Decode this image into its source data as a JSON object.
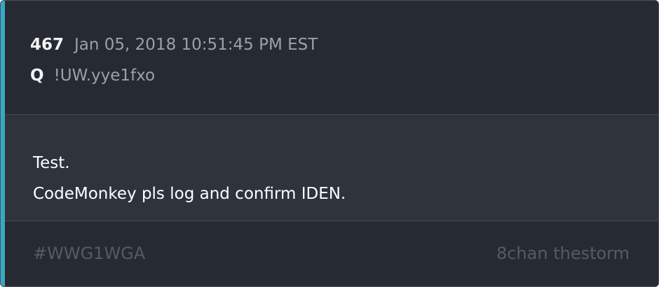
{
  "colors": {
    "card_background": "#262a32",
    "message_background": "#2e333c",
    "accent": "#38a8c4",
    "primary_text": "#f2f3f5",
    "secondary_text": "#9ba1aa",
    "muted_text": "#555b65",
    "divider": "#454b55"
  },
  "post": {
    "number": "467",
    "timestamp": "Jan 05, 2018 10:51:45 PM EST",
    "author": "Q",
    "tripcode": "!UW.yye1fxo",
    "message_lines": [
      "Test.",
      "CodeMonkey pls log and confirm IDEN."
    ]
  },
  "footer": {
    "hashtag": "#WWG1WGA",
    "source": "8chan thestorm"
  }
}
